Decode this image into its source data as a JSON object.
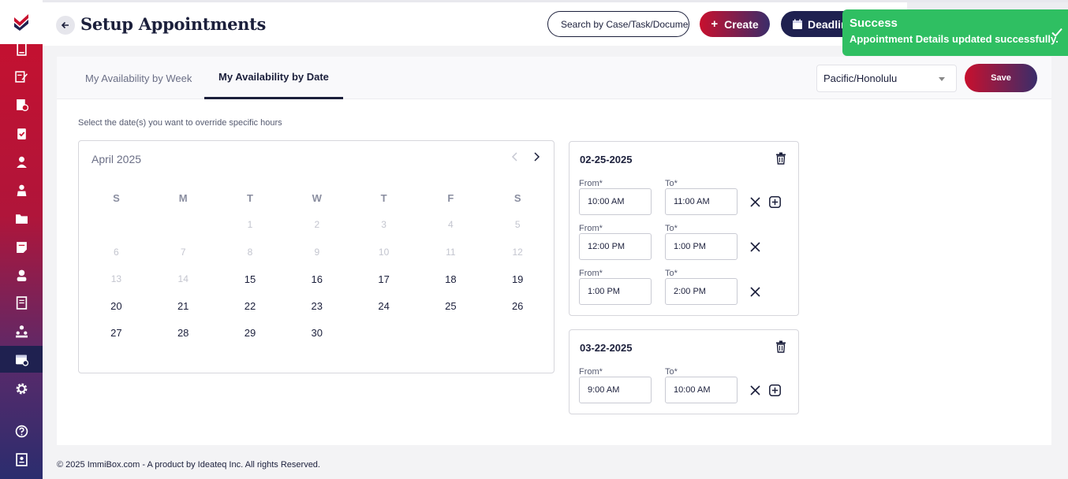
{
  "header": {
    "title": "Setup Appointments",
    "search_placeholder": "Search by Case/Task/Document",
    "create_label": "Create",
    "deadline_label": "Deadlines"
  },
  "toast": {
    "title": "Success",
    "message": "Appointment Details updated successfully."
  },
  "tabs": [
    {
      "label": "My Availability by Week"
    },
    {
      "label": "My Availability by Date"
    }
  ],
  "timezone": "Pacific/Honolulu",
  "save_label": "Save",
  "hint": "Select the date(s) you want to override specific hours",
  "calendar": {
    "month": "April 2025",
    "weekdays": [
      "S",
      "M",
      "T",
      "W",
      "T",
      "F",
      "S"
    ],
    "weeks": [
      [
        "",
        "",
        "1",
        "2",
        "3",
        "4",
        "5"
      ],
      [
        "6",
        "7",
        "8",
        "9",
        "10",
        "11",
        "12"
      ],
      [
        "13",
        "14",
        "15",
        "16",
        "17",
        "18",
        "19"
      ],
      [
        "20",
        "21",
        "22",
        "23",
        "24",
        "25",
        "26"
      ],
      [
        "27",
        "28",
        "29",
        "30",
        "",
        "",
        ""
      ]
    ],
    "disabled_through": 14
  },
  "overrides": [
    {
      "date": "02-25-2025",
      "slots": [
        {
          "from_label": "From*",
          "to_label": "To*",
          "from": "10:00 AM",
          "to": "11:00 AM",
          "can_add": true
        },
        {
          "from_label": "From*",
          "to_label": "To*",
          "from": "12:00 PM",
          "to": "1:00 PM",
          "can_add": false
        },
        {
          "from_label": "From*",
          "to_label": "To*",
          "from": "1:00 PM",
          "to": "2:00 PM",
          "can_add": false
        }
      ]
    },
    {
      "date": "03-22-2025",
      "slots": [
        {
          "from_label": "From*",
          "to_label": "To*",
          "from": "9:00 AM",
          "to": "10:00 AM",
          "can_add": true
        }
      ]
    }
  ],
  "footer": "© 2025 ImmiBox.com - A product by Ideateq Inc. All rights Reserved.",
  "colors": {
    "brand_red": "#c8102e",
    "brand_navy": "#1f2150",
    "success": "#2fbf62"
  },
  "sidebar_icons": [
    "logo-icon",
    "document-icon",
    "edit-icon",
    "case-icon",
    "clipboard-icon",
    "user-icon",
    "client-icon",
    "folder-icon",
    "note-icon",
    "contact-icon",
    "book-icon",
    "team-icon",
    "calendar-settings-icon",
    "gear-icon",
    "help-icon",
    "manual-icon"
  ]
}
